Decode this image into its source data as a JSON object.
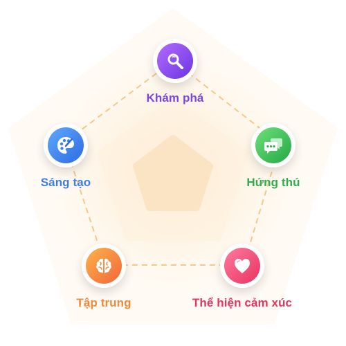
{
  "nodes": {
    "kham_pha": {
      "label": "Khám phá",
      "icon": "magnifier-icon",
      "color": "#7b45e6"
    },
    "sang_tao": {
      "label": "Sáng tạo",
      "icon": "paint-palette-icon",
      "color": "#3d7fe6"
    },
    "hung_thu": {
      "label": "Hứng thú",
      "icon": "chat-bubbles-icon",
      "color": "#2fae4e"
    },
    "tap_trung": {
      "label": "Tập trung",
      "icon": "brain-icon",
      "color": "#f0893a"
    },
    "the_hien_cam_xuc": {
      "label": "Thể hiện cảm xúc",
      "icon": "heart-icon",
      "color": "#e8335f"
    }
  },
  "colors": {
    "dashed_line": "#f5c98a",
    "background_glow": "#fde9c8",
    "center_pentagon": "#fbe3c4"
  }
}
